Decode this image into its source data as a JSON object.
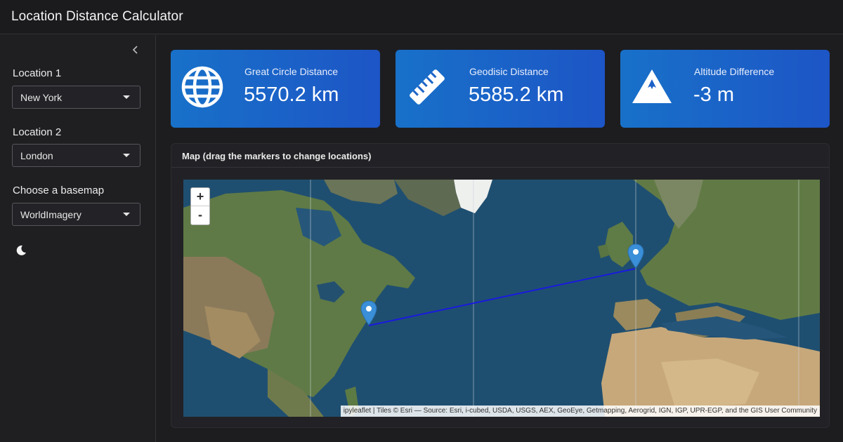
{
  "app": {
    "title": "Location Distance Calculator"
  },
  "sidebar": {
    "location1": {
      "label": "Location 1",
      "value": "New York"
    },
    "location2": {
      "label": "Location 2",
      "value": "London"
    },
    "basemap": {
      "label": "Choose a basemap",
      "value": "WorldImagery"
    },
    "collapse_icon": "chevron-left-icon",
    "theme_icon": "moon-icon"
  },
  "metrics": [
    {
      "title": "Great Circle Distance",
      "value": "5570.2 km",
      "icon": "globe-icon"
    },
    {
      "title": "Geodisic Distance",
      "value": "5585.2 km",
      "icon": "ruler-icon"
    },
    {
      "title": "Altitude Difference",
      "value": "-3 m",
      "icon": "mountain-icon"
    }
  ],
  "map": {
    "header": "Map (drag the markers to change locations)",
    "zoom_in": "+",
    "zoom_out": "-",
    "attribution": "ipyleaflet | Tiles © Esri — Source: Esri, i-cubed, USDA, USGS, AEX, GeoEye, Getmapping, Aerogrid, IGN, IGP, UPR-EGP, and the GIS User Community",
    "route_color": "#1a1adf",
    "marker_color": "#3a8fd8"
  },
  "colors": {
    "background": "#1d1d20",
    "card_gradient_start": "#1871c9",
    "card_gradient_end": "#1d55c6"
  }
}
